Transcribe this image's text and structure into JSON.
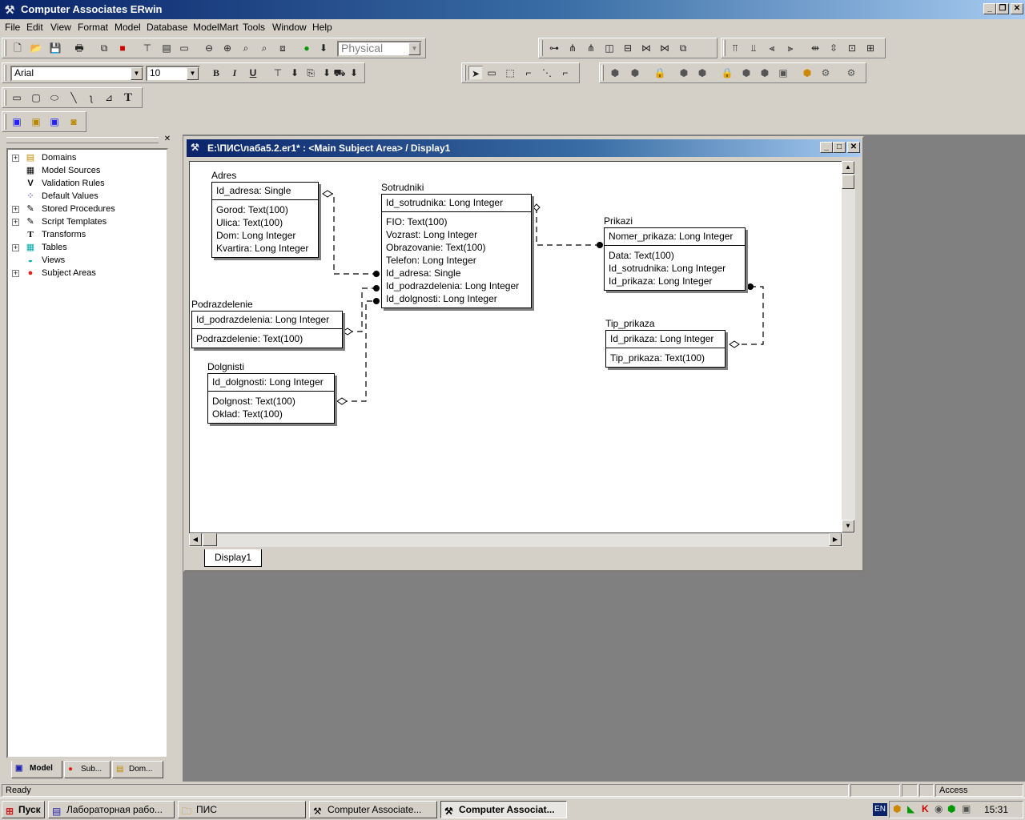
{
  "app": {
    "title": "Computer Associates ERwin"
  },
  "menu": [
    "File",
    "Edit",
    "View",
    "Format",
    "Model",
    "Database",
    "ModelMart",
    "Tools",
    "Window",
    "Help"
  ],
  "toolbar": {
    "view_level": "Physical",
    "font_name": "Arial",
    "font_size": "10",
    "bold": "B",
    "italic": "I",
    "underline": "U",
    "text_tool": "T"
  },
  "tree": [
    {
      "label": "Domains",
      "icon": "domains-icon",
      "expand": "+"
    },
    {
      "label": "Model Sources",
      "icon": "model-sources-icon",
      "expand": ""
    },
    {
      "label": "Validation Rules",
      "icon": "validation-rules-icon",
      "expand": ""
    },
    {
      "label": "Default Values",
      "icon": "default-values-icon",
      "expand": ""
    },
    {
      "label": "Stored Procedures",
      "icon": "stored-procedures-icon",
      "expand": "+"
    },
    {
      "label": "Script Templates",
      "icon": "script-templates-icon",
      "expand": "+"
    },
    {
      "label": "Transforms",
      "icon": "transforms-icon",
      "expand": ""
    },
    {
      "label": "Tables",
      "icon": "tables-icon",
      "expand": "+"
    },
    {
      "label": "Views",
      "icon": "views-icon",
      "expand": ""
    },
    {
      "label": "Subject Areas",
      "icon": "subject-areas-icon",
      "expand": "+"
    }
  ],
  "panel_tabs": [
    "Model",
    "Sub...",
    "Dom..."
  ],
  "document": {
    "title": "E:\\ПИС\\лаба5.2.er1* : <Main Subject Area> / Display1",
    "tab": "Display1"
  },
  "entities": [
    {
      "name": "Adres",
      "key": "Id_adresa: Single",
      "attrs": [
        "Gorod: Text(100)",
        "Ulica: Text(100)",
        "Dom: Long Integer",
        "Kvartira: Long Integer"
      ]
    },
    {
      "name": "Sotrudniki",
      "key": "Id_sotrudnika: Long Integer",
      "attrs": [
        "FIO: Text(100)",
        "Vozrast: Long Integer",
        "Obrazovanie: Text(100)",
        "Telefon: Long Integer",
        "Id_adresa: Single",
        "Id_podrazdelenia: Long Integer",
        "Id_dolgnosti: Long Integer"
      ]
    },
    {
      "name": "Prikazi",
      "key": "Nomer_prikaza: Long Integer",
      "attrs": [
        "Data: Text(100)",
        "Id_sotrudnika: Long Integer",
        "Id_prikaza: Long Integer"
      ]
    },
    {
      "name": "Podrazdelenie",
      "key": "Id_podrazdelenia: Long Integer",
      "attrs": [
        "Podrazdelenie: Text(100)"
      ]
    },
    {
      "name": "Dolgnisti",
      "key": "Id_dolgnosti: Long Integer",
      "attrs": [
        "Dolgnost: Text(100)",
        "Oklad: Text(100)"
      ]
    },
    {
      "name": "Tip_prikaza",
      "key": "Id_prikaza: Long Integer",
      "attrs": [
        "Tip_prikaza: Text(100)"
      ]
    }
  ],
  "status": {
    "text": "Ready",
    "db": "Access"
  },
  "taskbar": {
    "start": "Пуск",
    "buttons": [
      "Лабораторная рабо...",
      "ПИС",
      "Computer Associate...",
      "Computer Associat..."
    ],
    "lang": "EN",
    "clock": "15:31"
  }
}
